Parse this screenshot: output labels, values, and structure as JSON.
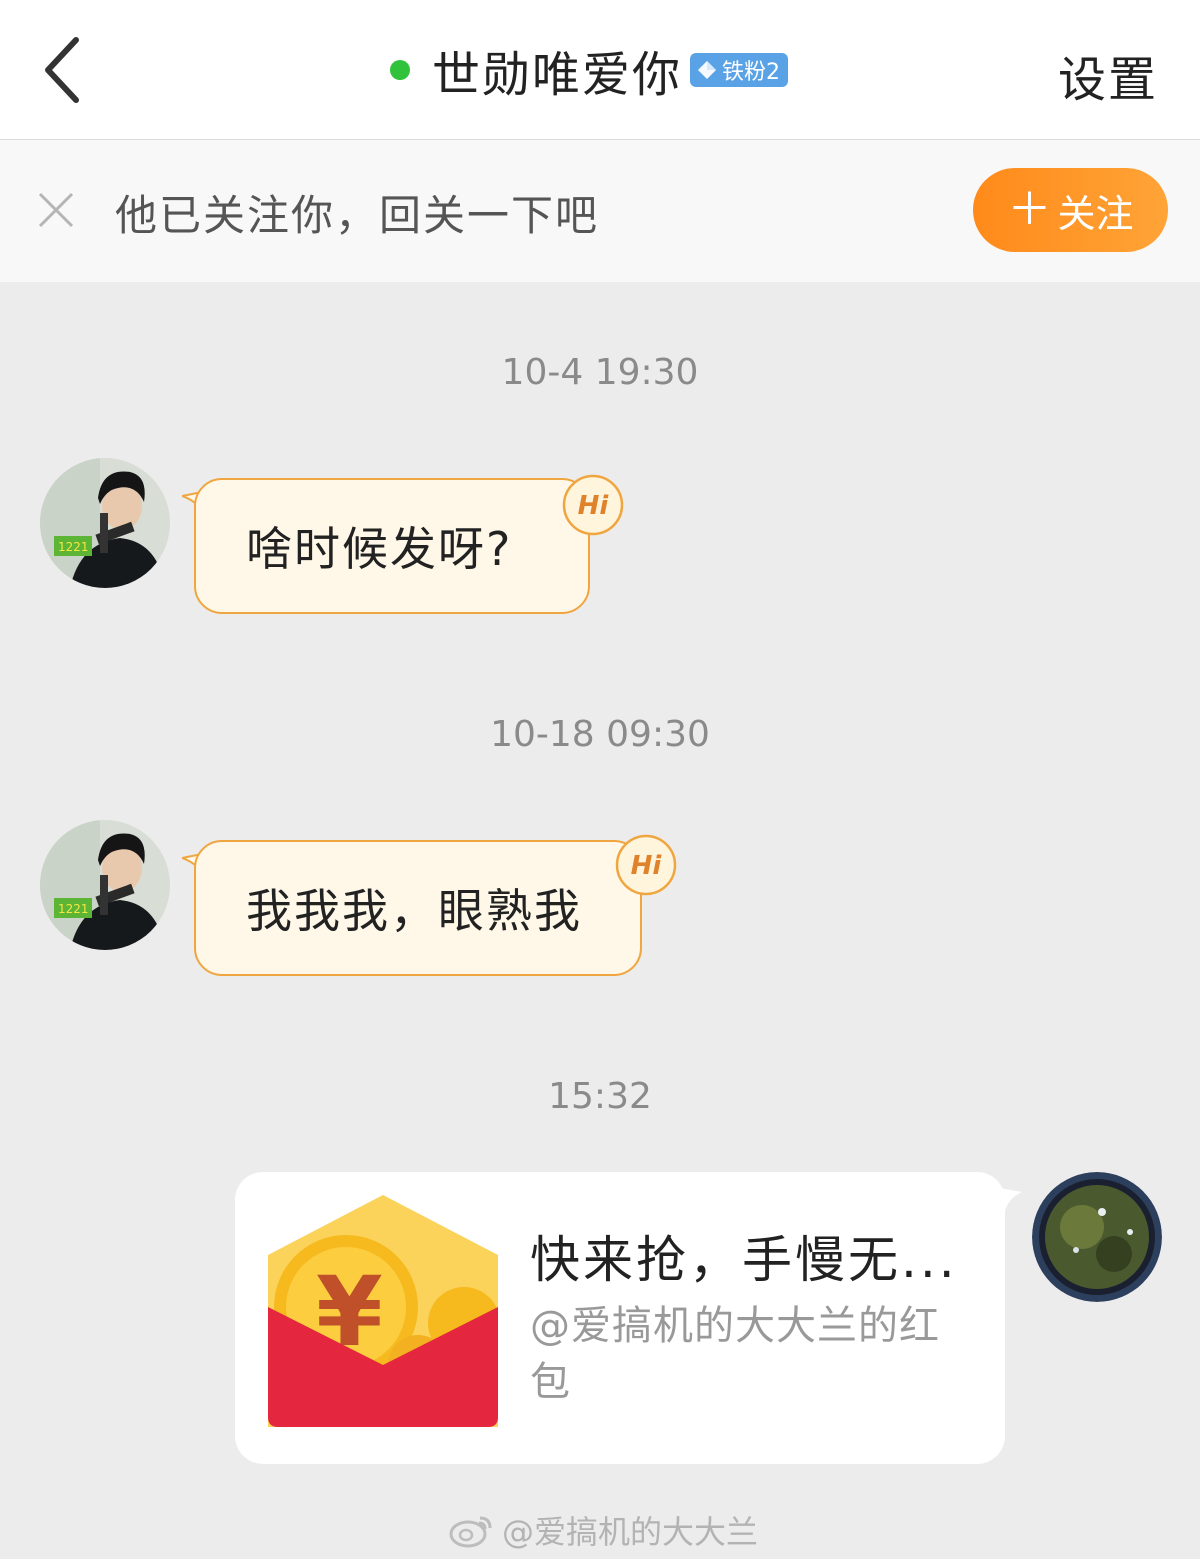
{
  "header": {
    "title": "世勋唯爱你",
    "fan_badge": "铁粉2",
    "settings_label": "设置"
  },
  "follow_bar": {
    "text": "他已关注你，回关一下吧",
    "button_plus": "＋",
    "button_label": "关注"
  },
  "messages": [
    {
      "timestamp": "10-4 19:30",
      "text": "啥时候发呀?",
      "badge": "Hi"
    },
    {
      "timestamp": "10-18 09:30",
      "text": "我我我，眼熟我",
      "badge": "Hi"
    },
    {
      "timestamp": "15:32"
    }
  ],
  "red_packet": {
    "title": "快来抢，手慢无...",
    "subtitle": "@爱搞机的大大兰的红包"
  },
  "watermark": "@爱搞机的大大兰",
  "colors": {
    "accent": "#ff9424",
    "online": "#2fc23a",
    "bubble_bg": "#fff8e8",
    "bubble_border": "#f0a640",
    "badge": "#5aa2e6",
    "packet_red": "#e4263f"
  }
}
